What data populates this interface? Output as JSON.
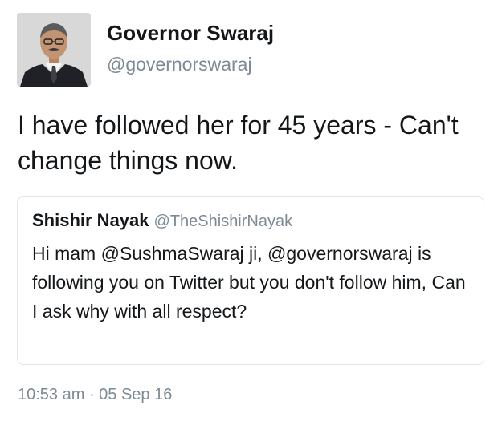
{
  "author": {
    "display_name": "Governor Swaraj",
    "handle": "@governorswaraj"
  },
  "tweet": {
    "text": "I have followed her for 45 years - Can't change things now."
  },
  "quoted_tweet": {
    "display_name": "Shishir Nayak",
    "handle": "@TheShishirNayak",
    "text": "Hi mam @SushmaSwaraj ji, @governorswaraj is following you on Twitter but you don't follow him, Can I ask why with all respect?"
  },
  "meta": {
    "timestamp": "10:53 am · 05 Sep 16"
  },
  "colors": {
    "text": "#14171a",
    "muted": "#7d8a96",
    "border": "#e1e8ed"
  }
}
